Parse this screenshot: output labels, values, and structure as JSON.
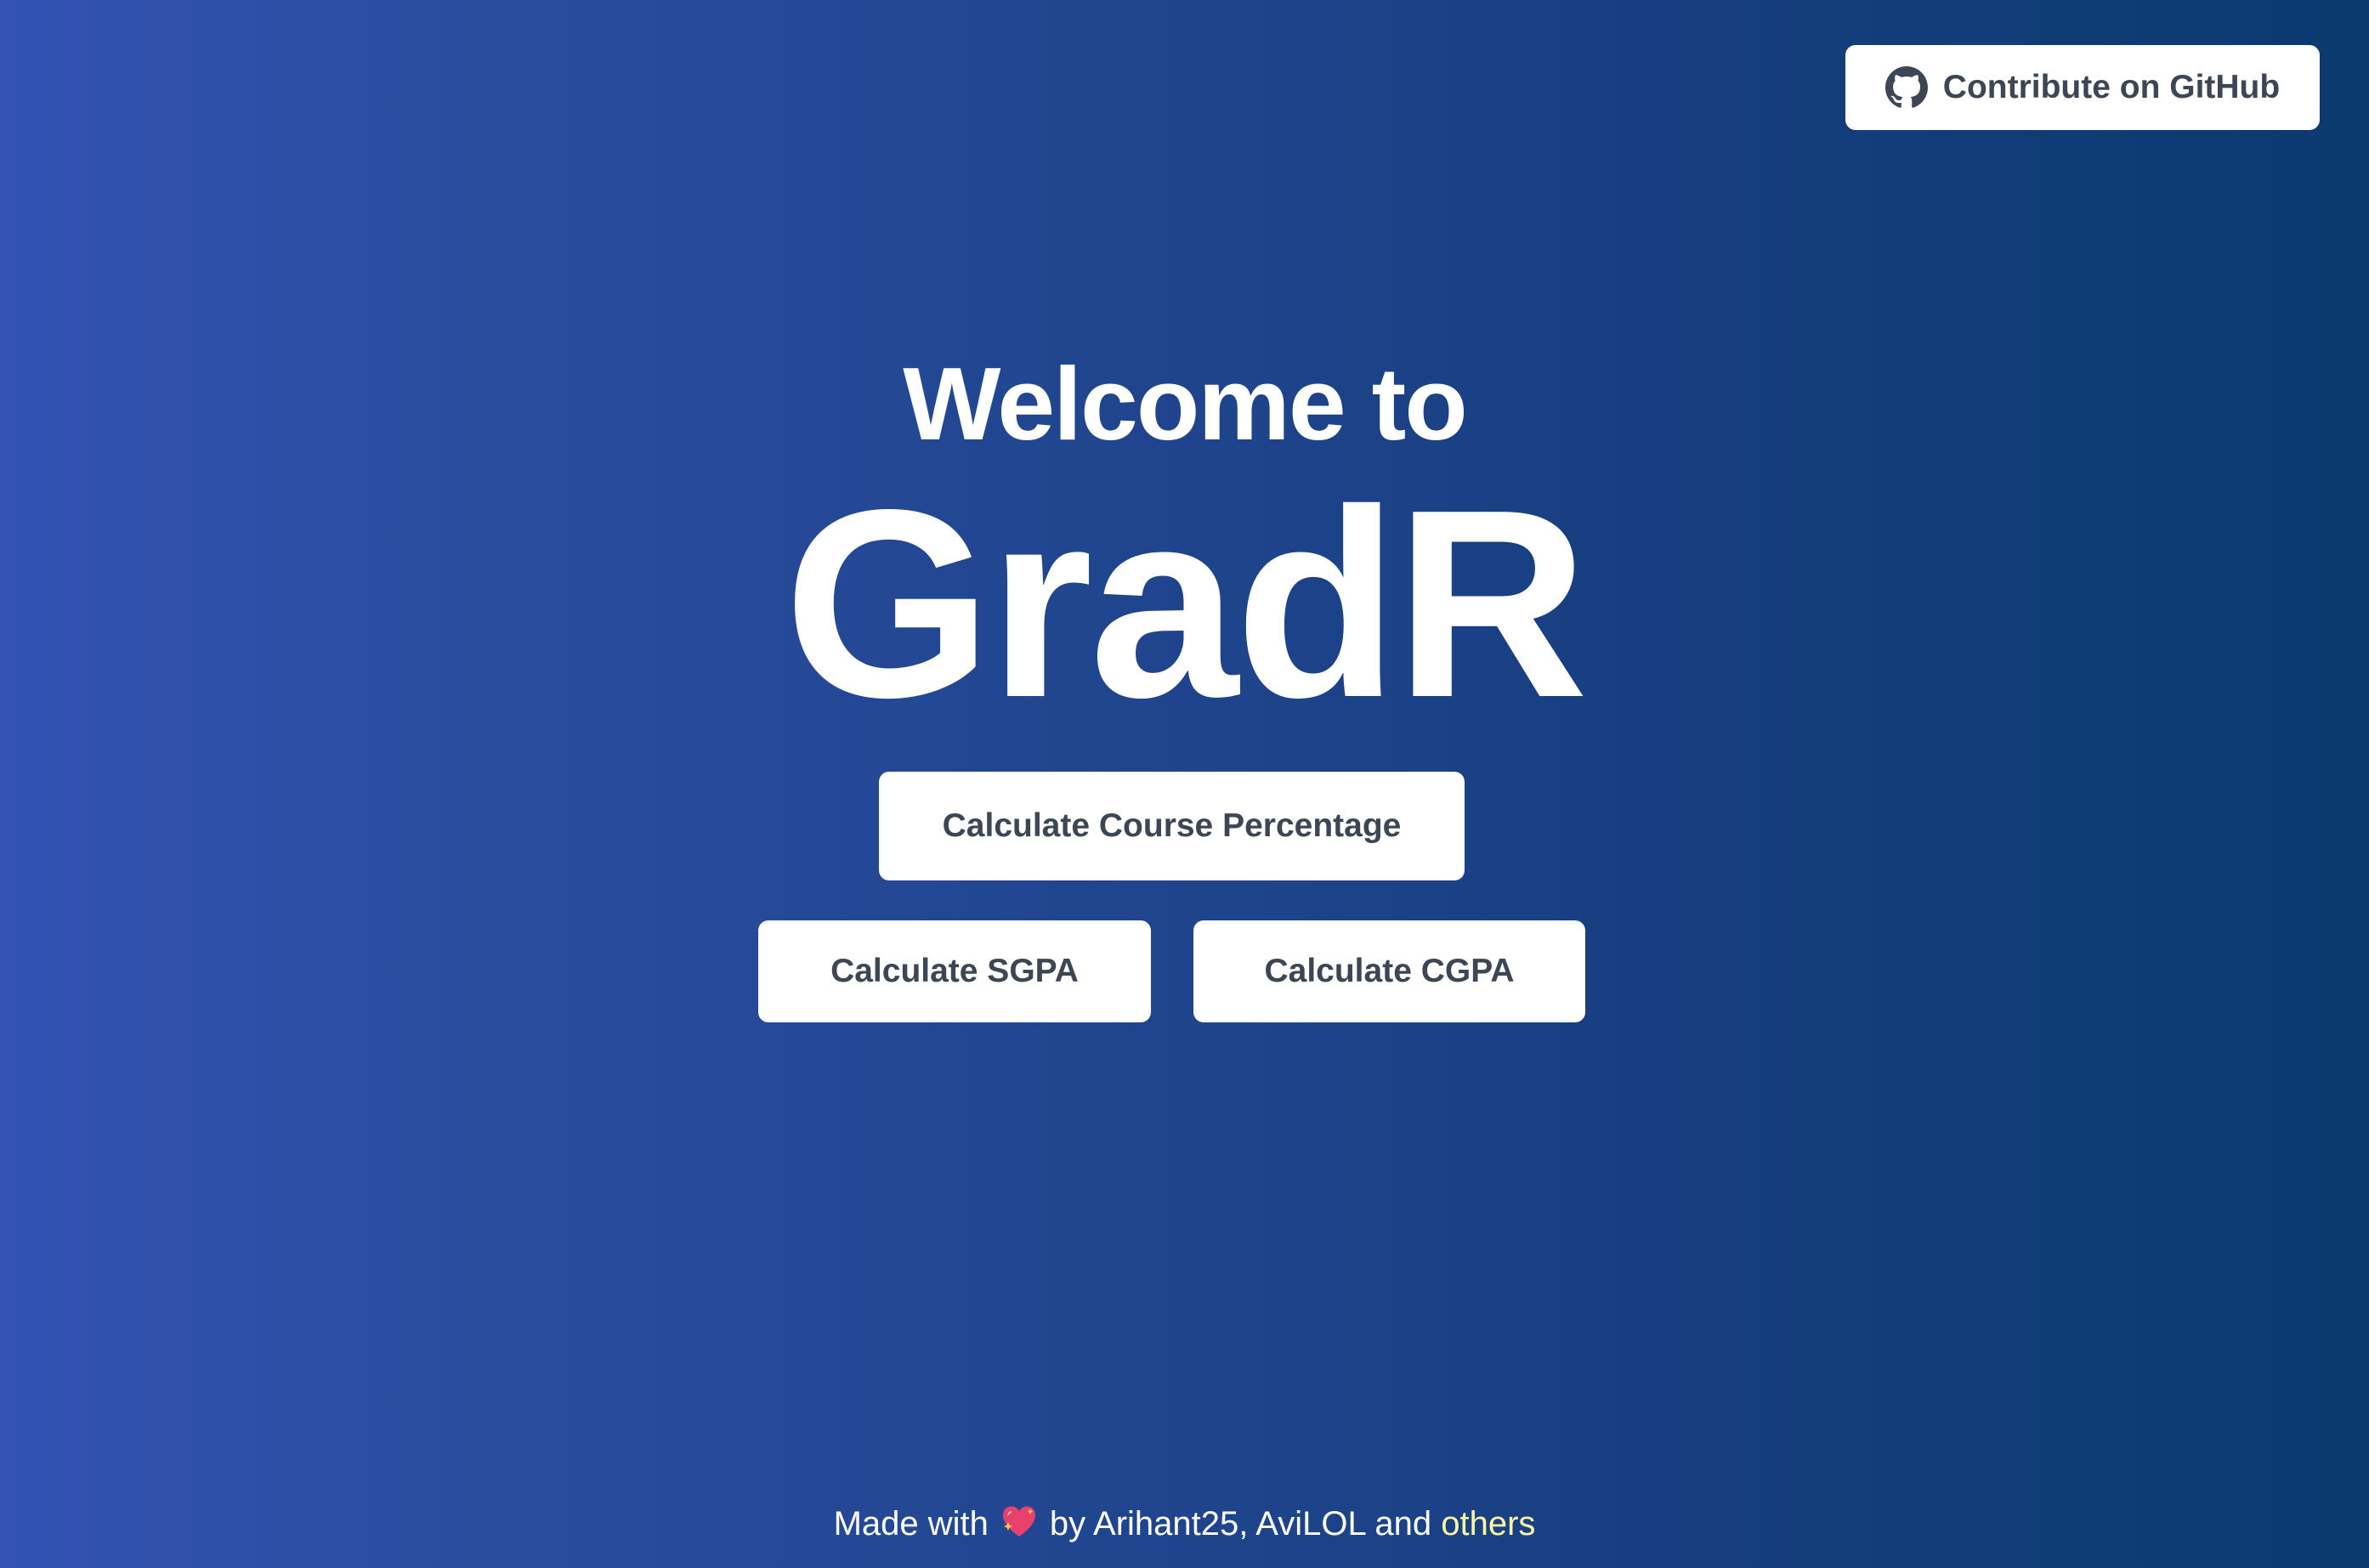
{
  "header": {
    "github_button_label": "Contribute on GitHub",
    "github_icon": "github-icon"
  },
  "hero": {
    "welcome_text": "Welcome to",
    "brand_name": "GradR"
  },
  "actions": {
    "course_percentage_label": "Calculate Course Percentage",
    "sgpa_label": "Calculate SGPA",
    "cgpa_label": "Calculate CGPA"
  },
  "footer": {
    "made_with": "Made with",
    "heart_icon": "sparkling-heart-icon",
    "by_text": "by Arihant25, AviLOL and",
    "others_link": "others"
  },
  "colors": {
    "background_start": "#3352b3",
    "background_end": "#0b3a6e",
    "button_bg": "#ffffff",
    "button_text": "#3d4654",
    "others_link": "#fdf7a2"
  }
}
